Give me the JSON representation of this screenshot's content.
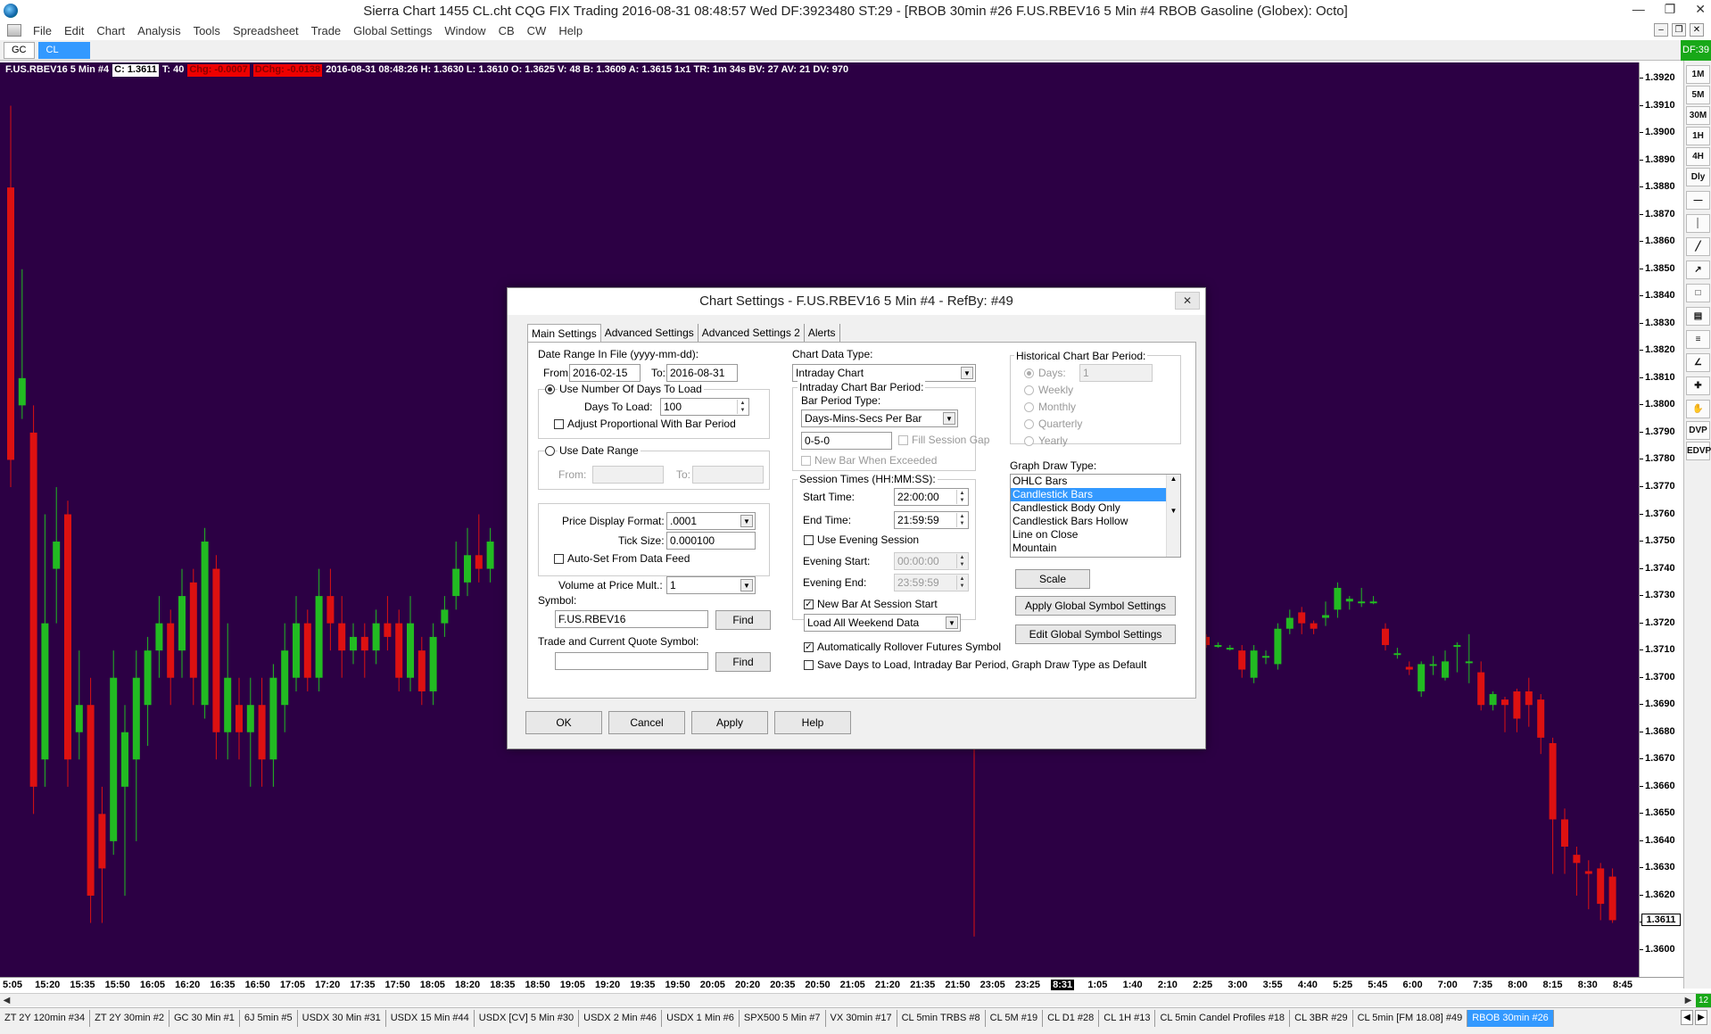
{
  "window": {
    "title": "Sierra Chart 1455 CL.cht  CQG FIX Trading 2016-08-31  08:48:57 Wed  DF:3923480  ST:29 - [RBOB 30min #26  F.US.RBEV16  5 Min   #4  RBOB Gasoline (Globex): Octo]"
  },
  "menu": [
    "File",
    "Edit",
    "Chart",
    "Analysis",
    "Tools",
    "Spreadsheet",
    "Trade",
    "Global Settings",
    "Window",
    "CB",
    "CW",
    "Help"
  ],
  "symbol_tabs": [
    {
      "label": "GC"
    },
    {
      "label": "CL"
    }
  ],
  "df_badge": "DF:39",
  "info_line": {
    "symbol": "F.US.RBEV16  5 Min   #4",
    "close": "C: 1.3611",
    "trades": "T: 40",
    "chg": "Chg: -0.0007",
    "dchg": "DChg: -0.0138",
    "details": "2016-08-31 08:48:26 H: 1.3630  L: 1.3610  O: 1.3625  V: 48  B: 1.3609  A: 1.3615  1x1  TR: 1m 34s  BV: 27  AV: 21  DV: 970"
  },
  "colors": {
    "chart_bg": "#2c0044",
    "up_candle": "#22bb22",
    "down_candle": "#dd1111",
    "accent_blue": "#3399ff",
    "badge_green": "#18a818"
  },
  "chart_data": {
    "type": "candlestick",
    "y_axis": {
      "min": 1.36,
      "max": 1.392,
      "tick_step": 0.001
    },
    "current_price": "1.3611",
    "time_ticks": [
      "5:05",
      "15:20",
      "15:35",
      "15:50",
      "16:05",
      "16:20",
      "16:35",
      "16:50",
      "17:05",
      "17:20",
      "17:35",
      "17:50",
      "18:05",
      "18:20",
      "18:35",
      "18:50",
      "19:05",
      "19:20",
      "19:35",
      "19:50",
      "20:05",
      "20:20",
      "20:35",
      "20:50",
      "21:05",
      "21:20",
      "21:35",
      "21:50",
      "23:05",
      "23:25",
      "8:31",
      "1:05",
      "1:40",
      "2:10",
      "2:25",
      "3:00",
      "3:55",
      "4:40",
      "5:25",
      "5:45",
      "6:00",
      "7:00",
      "7:35",
      "8:00",
      "8:15",
      "8:30",
      "8:45"
    ],
    "current_time_tick": "8:31",
    "candles_left": [
      [
        1.388,
        1.378,
        1.391,
        1.377
      ],
      [
        1.38,
        1.381,
        1.385,
        1.3795
      ],
      [
        1.379,
        1.366,
        1.38,
        1.365
      ],
      [
        1.367,
        1.372,
        1.376,
        1.366
      ],
      [
        1.374,
        1.375,
        1.377,
        1.372
      ],
      [
        1.376,
        1.367,
        1.3765,
        1.366
      ],
      [
        1.368,
        1.369,
        1.371,
        1.367
      ],
      [
        1.369,
        1.362,
        1.37,
        1.361
      ],
      [
        1.365,
        1.363,
        1.366,
        1.361
      ],
      [
        1.364,
        1.37,
        1.371,
        1.3635
      ],
      [
        1.366,
        1.368,
        1.369,
        1.362
      ],
      [
        1.367,
        1.37,
        1.371,
        1.364
      ],
      [
        1.369,
        1.371,
        1.3715,
        1.3675
      ],
      [
        1.371,
        1.372,
        1.373,
        1.37
      ],
      [
        1.372,
        1.37,
        1.3725,
        1.369
      ],
      [
        1.371,
        1.373,
        1.374,
        1.37
      ],
      [
        1.3735,
        1.37,
        1.374,
        1.369
      ],
      [
        1.369,
        1.375,
        1.3755,
        1.3685
      ],
      [
        1.374,
        1.368,
        1.3745,
        1.367
      ],
      [
        1.368,
        1.37,
        1.372,
        1.367
      ],
      [
        1.369,
        1.368,
        1.37,
        1.367
      ],
      [
        1.368,
        1.369,
        1.37,
        1.366
      ],
      [
        1.369,
        1.367,
        1.37,
        1.366
      ],
      [
        1.367,
        1.37,
        1.3705,
        1.366
      ],
      [
        1.369,
        1.371,
        1.372,
        1.368
      ],
      [
        1.37,
        1.372,
        1.373,
        1.3695
      ],
      [
        1.372,
        1.37,
        1.3725,
        1.3695
      ],
      [
        1.37,
        1.373,
        1.374,
        1.3695
      ],
      [
        1.373,
        1.372,
        1.374,
        1.371
      ],
      [
        1.372,
        1.371,
        1.373,
        1.37
      ],
      [
        1.371,
        1.3715,
        1.372,
        1.3705
      ],
      [
        1.3715,
        1.371,
        1.372,
        1.37
      ],
      [
        1.371,
        1.372,
        1.3725,
        1.3705
      ],
      [
        1.372,
        1.3715,
        1.373,
        1.371
      ],
      [
        1.372,
        1.37,
        1.3725,
        1.3695
      ],
      [
        1.37,
        1.372,
        1.373,
        1.3695
      ],
      [
        1.371,
        1.3695,
        1.3715,
        1.369
      ],
      [
        1.3695,
        1.3715,
        1.372,
        1.369
      ],
      [
        1.372,
        1.3725,
        1.373,
        1.3715
      ],
      [
        1.373,
        1.374,
        1.375,
        1.3725
      ],
      [
        1.3735,
        1.3745,
        1.3755,
        1.373
      ],
      [
        1.3745,
        1.374,
        1.376,
        1.3735
      ],
      [
        1.374,
        1.375,
        1.3755,
        1.3735
      ]
    ],
    "candles_right": [
      [
        1.3715,
        1.3712,
        1.3716,
        1.3711
      ],
      [
        1.3712,
        1.3712,
        1.3713,
        1.3711
      ],
      [
        1.3711,
        1.3711,
        1.3712,
        1.371
      ],
      [
        1.371,
        1.3703,
        1.3712,
        1.37
      ],
      [
        1.37,
        1.371,
        1.3712,
        1.3698
      ],
      [
        1.3708,
        1.3708,
        1.371,
        1.3705
      ],
      [
        1.3705,
        1.3718,
        1.372,
        1.3703
      ],
      [
        1.3718,
        1.3722,
        1.3725,
        1.3716
      ],
      [
        1.3724,
        1.372,
        1.3726,
        1.3716
      ],
      [
        1.372,
        1.3718,
        1.3721,
        1.3716
      ],
      [
        1.3722,
        1.3723,
        1.3728,
        1.3719
      ],
      [
        1.3725,
        1.3733,
        1.3735,
        1.3722
      ],
      [
        1.3728,
        1.3729,
        1.373,
        1.3725
      ],
      [
        1.3728,
        1.3728,
        1.3733,
        1.3726
      ],
      [
        1.3728,
        1.3728,
        1.373,
        1.3727
      ],
      [
        1.3718,
        1.3712,
        1.372,
        1.371
      ],
      [
        1.3709,
        1.3709,
        1.3711,
        1.3707
      ],
      [
        1.3704,
        1.3703,
        1.3706,
        1.3701
      ],
      [
        1.3695,
        1.3705,
        1.3706,
        1.3693
      ],
      [
        1.3705,
        1.3705,
        1.3708,
        1.3701
      ],
      [
        1.37,
        1.3706,
        1.371,
        1.3699
      ],
      [
        1.3712,
        1.3712,
        1.3713,
        1.3702
      ],
      [
        1.3706,
        1.3706,
        1.3716,
        1.3698
      ],
      [
        1.3702,
        1.369,
        1.3706,
        1.3688
      ],
      [
        1.369,
        1.3694,
        1.3695,
        1.3688
      ],
      [
        1.3692,
        1.369,
        1.3693,
        1.368
      ],
      [
        1.3695,
        1.3685,
        1.3696,
        1.368
      ],
      [
        1.3695,
        1.369,
        1.37,
        1.3682
      ],
      [
        1.3692,
        1.3678,
        1.3694,
        1.3672
      ],
      [
        1.3676,
        1.3648,
        1.3678,
        1.3628
      ],
      [
        1.3648,
        1.3638,
        1.3652,
        1.3628
      ],
      [
        1.3635,
        1.3632,
        1.3638,
        1.362
      ],
      [
        1.3629,
        1.3628,
        1.3633,
        1.3615
      ],
      [
        1.363,
        1.3617,
        1.3632,
        1.3611
      ],
      [
        1.3627,
        1.3611,
        1.363,
        1.361
      ]
    ]
  },
  "right_toolbar": [
    "1M",
    "5M",
    "30M",
    "1H",
    "4H",
    "Dly",
    "DVP",
    "EDVP"
  ],
  "bottom_tabs": [
    "ZT 2Y 120min #34",
    "ZT 2Y 30min #2",
    "GC 30 Min #1",
    "6J 5min #5",
    "USDX  30 Min  #31",
    "USDX  15 Min  #44",
    "USDX [CV]  5 Min  #30",
    "USDX  2 Min  #46",
    "USDX  1 Min  #6",
    "SPX500  5 Min  #7",
    "VX 30min #17",
    "CL 5min TRBS #8",
    "CL 5M #19",
    "CL D1 #28",
    "CL 1H #13",
    "CL 5min Candel Profiles #18",
    "CL 3BR #29",
    "CL 5min [FM 18.08] #49",
    "RBOB 30min #26"
  ],
  "scroll_badge": "12",
  "dialog": {
    "title": "Chart Settings - F.US.RBEV16  5 Min   #4 - RefBy: #49",
    "tabs": [
      "Main Settings",
      "Advanced Settings",
      "Advanced Settings 2",
      "Alerts"
    ],
    "date_range_label": "Date Range In File (yyyy-mm-dd):",
    "from_label": "From:",
    "from_value": "2016-02-15",
    "to_label": "To:",
    "to_value": "2016-08-31",
    "use_days_label": "Use Number Of Days To Load",
    "days_to_load_label": "Days To Load:",
    "days_to_load_value": "100",
    "adjust_label": "Adjust Proportional With Bar Period",
    "use_date_range_label": "Use Date Range",
    "dr_from_label": "From:",
    "dr_to_label": "To:",
    "price_format_label": "Price Display Format:",
    "price_format_value": ".0001",
    "tick_size_label": "Tick Size:",
    "tick_size_value": "0.000100",
    "autoset_label": "Auto-Set From Data Feed",
    "vol_mult_label": "Volume at Price Mult.:",
    "vol_mult_value": "1",
    "symbol_label": "Symbol:",
    "symbol_value": "F.US.RBEV16",
    "find_label": "Find",
    "trade_quote_label": "Trade and Current Quote Symbol:",
    "trade_quote_value": "",
    "chart_data_type_label": "Chart Data Type:",
    "chart_data_type_value": "Intraday Chart",
    "intraday_period_label": "Intraday Chart Bar Period:",
    "bar_period_type_label": "Bar Period Type:",
    "bar_period_type_value": "Days-Mins-Secs Per Bar",
    "bar_period_value": "0-5-0",
    "fill_session_gap_label": "Fill Session Gap",
    "new_bar_exceeded_label": "New Bar When Exceeded",
    "session_times_label": "Session Times (HH:MM:SS):",
    "start_time_label": "Start Time:",
    "start_time_value": "22:00:00",
    "end_time_label": "End Time:",
    "end_time_value": "21:59:59",
    "use_evening_label": "Use Evening Session",
    "evening_start_label": "Evening Start:",
    "evening_start_value": "00:00:00",
    "evening_end_label": "Evening End:",
    "evening_end_value": "23:59:59",
    "new_bar_session_label": "New Bar At Session Start",
    "weekend_value": "Load All Weekend Data",
    "auto_rollover_label": "Automatically Rollover Futures Symbol",
    "save_days_label": "Save Days to Load, Intraday Bar Period, Graph Draw Type as Default",
    "hist_period_label": "Historical Chart Bar Period:",
    "hist_days_label": "Days:",
    "hist_days_value": "1",
    "hist_weekly": "Weekly",
    "hist_monthly": "Monthly",
    "hist_quarterly": "Quarterly",
    "hist_yearly": "Yearly",
    "graph_draw_label": "Graph Draw Type:",
    "graph_draw_options": [
      "OHLC Bars",
      "Candlestick Bars",
      "Candlestick Body Only",
      "Candlestick Bars Hollow",
      "Line on Close",
      "Mountain"
    ],
    "graph_draw_selected": 1,
    "scale_label": "Scale",
    "apply_global_label": "Apply Global Symbol Settings",
    "edit_global_label": "Edit Global Symbol Settings",
    "ok_label": "OK",
    "cancel_label": "Cancel",
    "apply_label": "Apply",
    "help_label": "Help"
  }
}
